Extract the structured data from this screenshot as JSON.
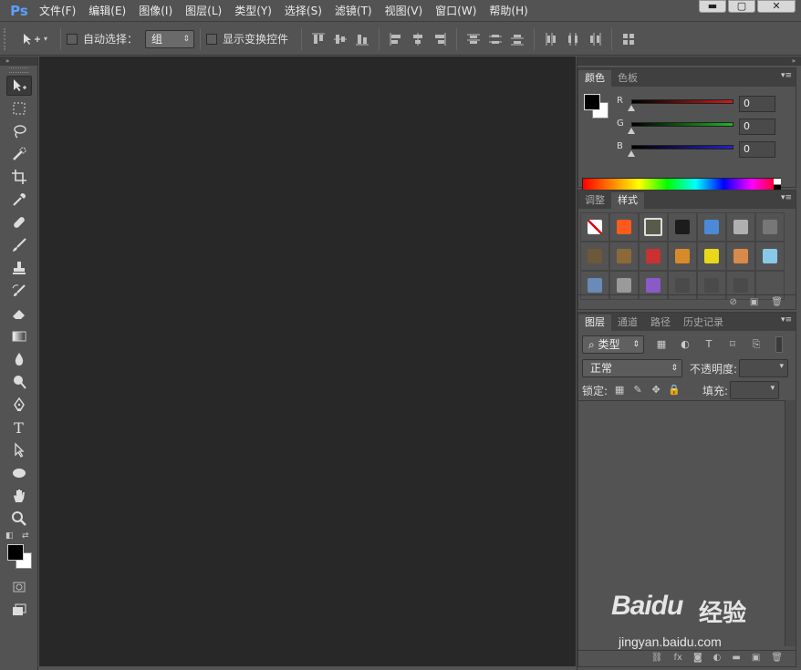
{
  "app": {
    "logo": "Ps"
  },
  "menu": [
    "文件(F)",
    "编辑(E)",
    "图像(I)",
    "图层(L)",
    "类型(Y)",
    "选择(S)",
    "滤镜(T)",
    "视图(V)",
    "窗口(W)",
    "帮助(H)"
  ],
  "window_controls": {
    "minimize": "▬",
    "maximize": "▢",
    "close": "✕"
  },
  "options_bar": {
    "auto_select_label": "自动选择：",
    "auto_select_value": "组",
    "show_transform_label": "显示变换控件"
  },
  "tools": [
    "move-tool-icon",
    "marquee-tool-icon",
    "lasso-tool-icon",
    "quick-select-tool-icon",
    "crop-tool-icon",
    "eyedropper-tool-icon",
    "healing-brush-tool-icon",
    "brush-tool-icon",
    "clone-stamp-tool-icon",
    "history-brush-tool-icon",
    "eraser-tool-icon",
    "gradient-tool-icon",
    "blur-tool-icon",
    "dodge-tool-icon",
    "pen-tool-icon",
    "type-tool-icon",
    "path-select-tool-icon",
    "ellipse-tool-icon",
    "hand-tool-icon",
    "zoom-tool-icon"
  ],
  "type_tool_glyph": "T",
  "color_panel": {
    "tabs": [
      "颜色",
      "色板"
    ],
    "channels": [
      {
        "label": "R",
        "value": "0",
        "color": "#c81e1e"
      },
      {
        "label": "G",
        "value": "0",
        "color": "#22b422"
      },
      {
        "label": "B",
        "value": "0",
        "color": "#2222c8"
      }
    ],
    "foreground": "#000000",
    "background": "#ffffff"
  },
  "styles_panel": {
    "tabs": [
      "调整",
      "样式"
    ],
    "swatches": [
      "#ffffff",
      "#ff5a1e",
      "#5a5a4a",
      "#1c1c1c",
      "#4a8ad8",
      "#b0b0b0",
      "#777777",
      "#6a5a3a",
      "#8a6a3a",
      "#c83232",
      "#d88a2a",
      "#e8d81a",
      "#d88a4a",
      "#8ac8e8",
      "#6a8ab8",
      "#9a9a9a",
      "#8a5ac8",
      "#4a4a4a",
      "#4a4a4a",
      "#4a4a4a",
      ""
    ]
  },
  "layers_panel": {
    "tabs": [
      "图层",
      "通道",
      "路径",
      "历史记录"
    ],
    "filter_label": "类型",
    "blend_mode": "正常",
    "opacity_label": "不透明度:",
    "lock_label": "锁定:",
    "fill_label": "填充:",
    "footer_icons": [
      "link-icon",
      "fx-icon",
      "mask-icon",
      "adjustment-icon",
      "folder-icon",
      "new-layer-icon",
      "trash-icon"
    ]
  },
  "watermark": {
    "brand": "Baidu",
    "brand_cn": "经验",
    "url": "jingyan.baidu.com"
  }
}
